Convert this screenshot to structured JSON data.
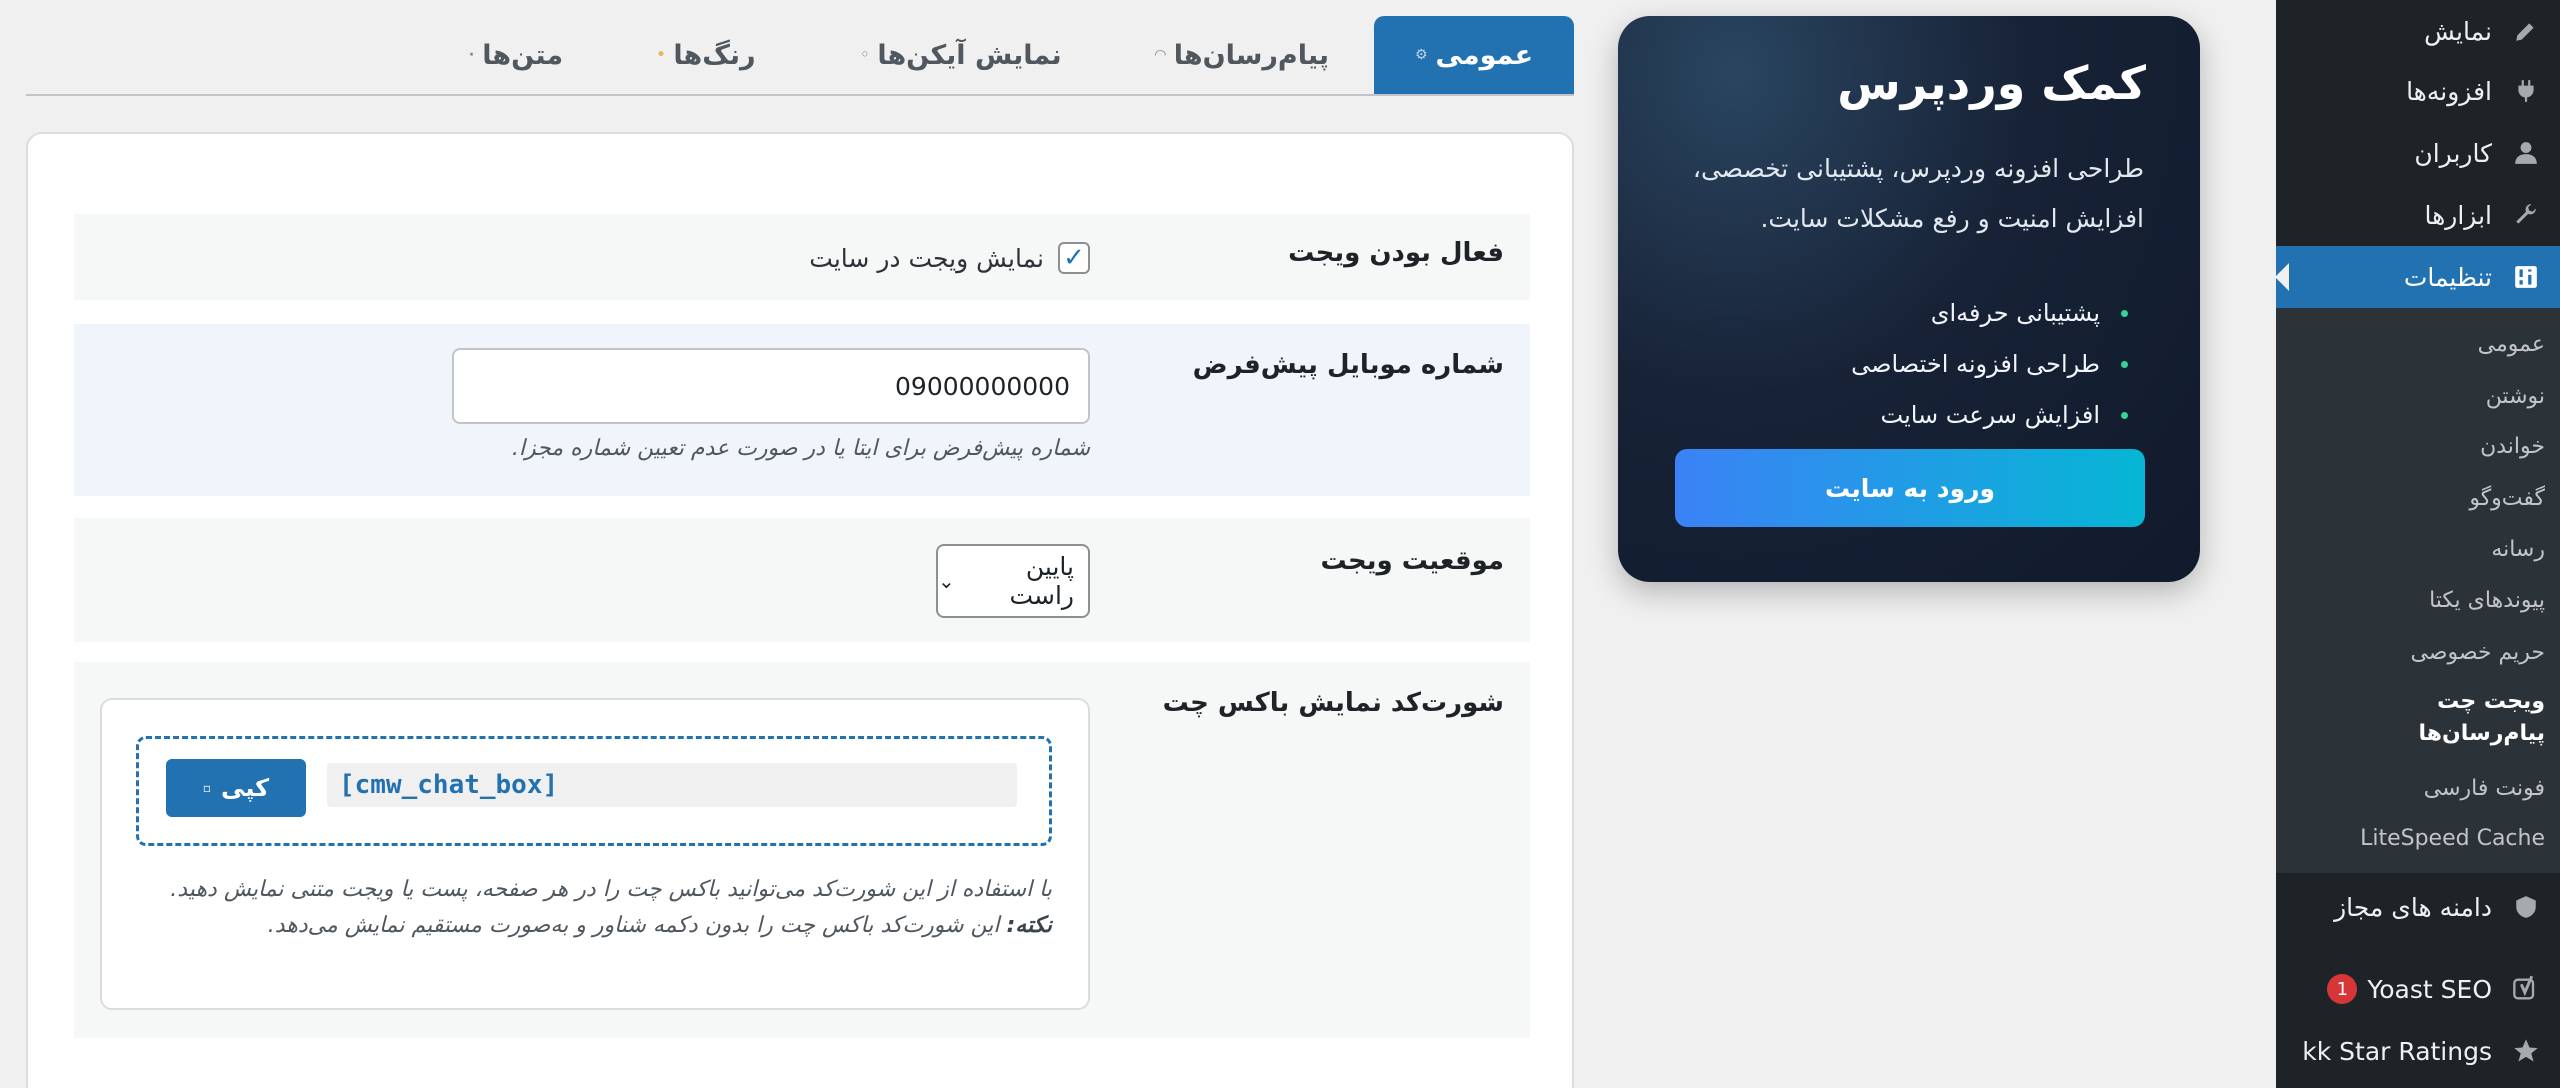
{
  "sidebar": {
    "top_items": [
      {
        "label": "نمایش",
        "icon": "paintbrush-icon"
      },
      {
        "label": "افزونه‌ها",
        "icon": "plugin-icon"
      },
      {
        "label": "کاربران",
        "icon": "user-icon"
      },
      {
        "label": "ابزارها",
        "icon": "wrench-icon"
      },
      {
        "label": "تنظیمات",
        "icon": "settings-icon"
      }
    ],
    "submenu": [
      {
        "label": "عمومی"
      },
      {
        "label": "نوشتن"
      },
      {
        "label": "خواندن"
      },
      {
        "label": "گفت‌وگو"
      },
      {
        "label": "رسانه"
      },
      {
        "label": "پیوندهای یکتا"
      },
      {
        "label": "حریم خصوصی"
      },
      {
        "label": "ویجت چت پیام‌رسان‌ها"
      },
      {
        "label": "فونت فارسی"
      },
      {
        "label": "LiteSpeed Cache"
      }
    ],
    "bottom_items": [
      {
        "label": "دامنه های مجاز",
        "icon": "shield-icon"
      },
      {
        "label": "Yoast SEO",
        "icon": "yoast-icon",
        "badge": "1"
      },
      {
        "label": "kk Star Ratings",
        "icon": "star-icon"
      }
    ]
  },
  "promo": {
    "title": "کمک وردپرس",
    "description": "طراحی افزونه وردپرس، پشتیبانی تخصصی، افزایش امنیت و رفع مشکلات سایت.",
    "features": [
      "پشتیبانی حرفه‌ای",
      "طراحی افزونه اختصاصی",
      "افزایش سرعت سایت"
    ],
    "cta": "ورود به سایت"
  },
  "tabs": [
    {
      "label": "عمومی",
      "active": true
    },
    {
      "label": "پیام‌رسان‌ها"
    },
    {
      "label": "نمایش آیکن‌ها"
    },
    {
      "label": "رنگ‌ها"
    },
    {
      "label": "متن‌ها"
    }
  ],
  "form": {
    "active": {
      "label": "فعال بودن ویجت",
      "checkbox_label": "نمایش ویجت در سایت",
      "checked": true
    },
    "mobile": {
      "label": "شماره موبایل پیش‌فرض",
      "value": "09000000000",
      "help": "شماره پیش‌فرض برای ایتا یا در صورت عدم تعیین شماره مجزا."
    },
    "position": {
      "label": "موقعیت ویجت",
      "selected": "پایین راست"
    },
    "shortcode": {
      "label": "شورت‌کد نمایش باکس چت",
      "code": "[cmw_chat_box]",
      "copy_label": "کپی",
      "help": "با استفاده از این شورت‌کد می‌توانید باکس چت را در هر صفحه، پست یا ویجت متنی نمایش دهید.",
      "note_label": "نکته:",
      "note": "این شورت‌کد باکس چت را بدون دکمه شناور و به‌صورت مستقیم نمایش می‌دهد."
    }
  },
  "colors": {
    "accent": "#2271b1",
    "sidebar_bg": "#1d2327",
    "submenu_bg": "#2c3338",
    "badge": "#d63638",
    "promo_bg": "#172236"
  }
}
